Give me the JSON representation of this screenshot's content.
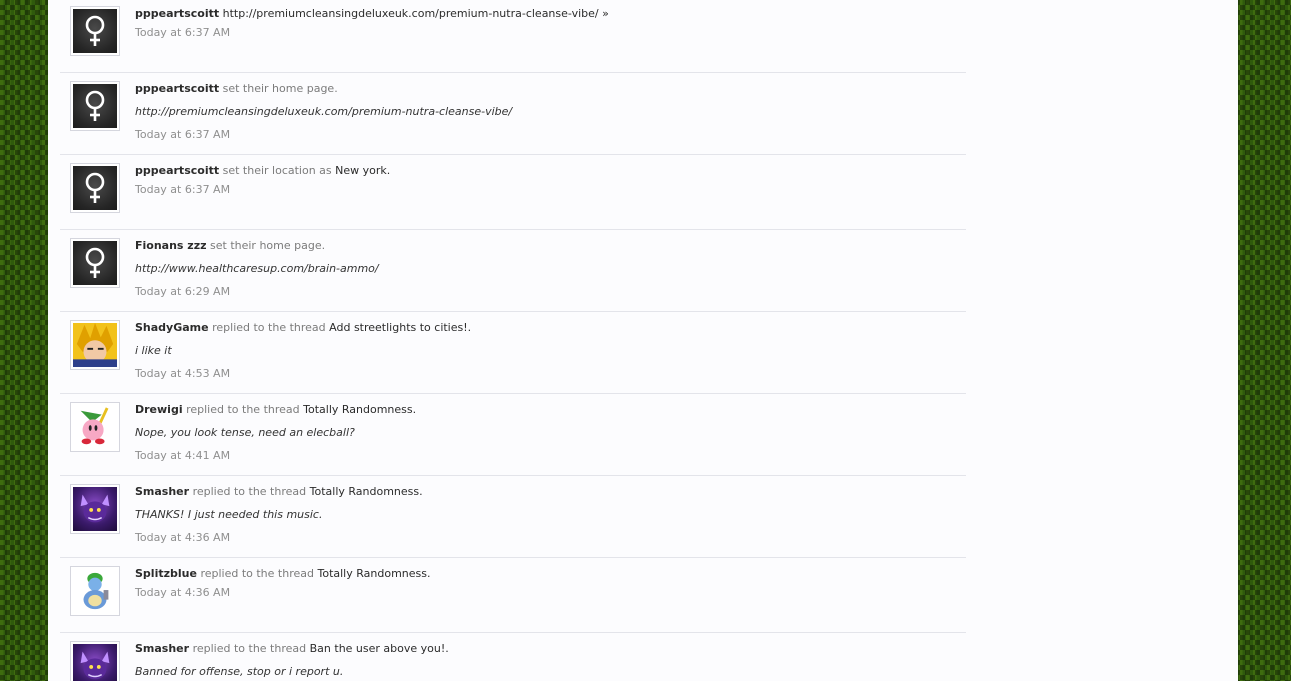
{
  "feed": [
    {
      "user": "pppeartscoitt",
      "action": "",
      "target": "http://premiumcleansingdeluxeuk.com/premium-nutra-cleanse-vibe/ »",
      "snippet": "",
      "time": "Today at 6:37 AM",
      "avatar": "female-symbol-icon"
    },
    {
      "user": "pppeartscoitt",
      "action": "set their home page.",
      "target": "",
      "snippet": "http://premiumcleansingdeluxeuk.com/premium-nutra-cleanse-vibe/",
      "time": "Today at 6:37 AM",
      "avatar": "female-symbol-icon"
    },
    {
      "user": "pppeartscoitt",
      "action": "set their location as",
      "target": "New york.",
      "snippet": "",
      "time": "Today at 6:37 AM",
      "avatar": "female-symbol-icon"
    },
    {
      "user": "Fionans zzz",
      "action": "set their home page.",
      "target": "",
      "snippet": "http://www.healthcaresup.com/brain-ammo/",
      "time": "Today at 6:29 AM",
      "avatar": "female-symbol-icon"
    },
    {
      "user": "ShadyGame",
      "action": "replied to the thread",
      "target": "Add streetlights to cities!.",
      "snippet": "i like it",
      "time": "Today at 4:53 AM",
      "avatar": "anime-character-avatar"
    },
    {
      "user": "Drewigi",
      "action": "replied to the thread",
      "target": "Totally Randomness.",
      "snippet": "Nope, you look tense, need an elecball?",
      "time": "Today at 4:41 AM",
      "avatar": "kirby-sword-avatar"
    },
    {
      "user": "Smasher",
      "action": "replied to the thread",
      "target": "Totally Randomness.",
      "snippet": "THANKS! I just needed this music.",
      "time": "Today at 4:36 AM",
      "avatar": "purple-monster-avatar"
    },
    {
      "user": "Splitzblue",
      "action": "replied to the thread",
      "target": "Totally Randomness.",
      "snippet": "",
      "time": "Today at 4:36 AM",
      "avatar": "blue-turtle-avatar"
    },
    {
      "user": "Smasher",
      "action": "replied to the thread",
      "target": "Ban the user above you!.",
      "snippet": "Banned for offense, stop or i report u.",
      "time": "",
      "avatar": "purple-monster-avatar"
    }
  ],
  "colors": {
    "page_background": "#fcfcfe",
    "outer_background": "#2f5a0c",
    "username": "#2b2b2b",
    "meta_text": "#8f8f8f",
    "divider": "#e3e4ea"
  }
}
